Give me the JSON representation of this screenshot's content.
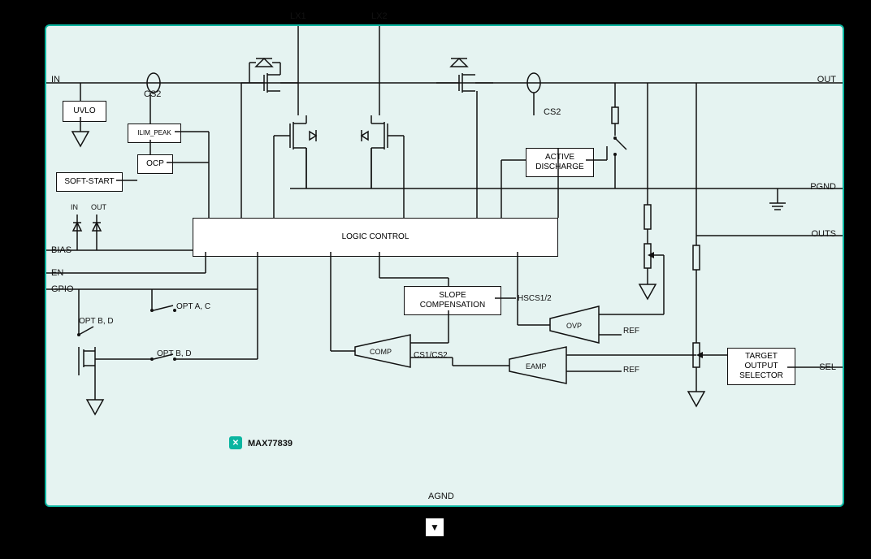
{
  "part": "MAX77839",
  "pins": {
    "in": "IN",
    "out": "OUT",
    "lx1": "LX1",
    "lx2": "LX2",
    "bias": "BIAS",
    "en": "EN",
    "gpio": "GPIO",
    "pgnd": "PGND",
    "outs": "OUTS",
    "sel": "SEL",
    "agnd": "AGND"
  },
  "blocks": {
    "uvlo": "UVLO",
    "ilim": "ILIM_PEAK",
    "ocp": "OCP",
    "softstart": "SOFT-START",
    "logic": "LOGIC CONTROL",
    "slope": "SLOPE COMPENSATION",
    "active": "ACTIVE DISCHARGE",
    "target": "TARGET OUTPUT SELECTOR",
    "ovp": "OVP",
    "eamp": "EAMP",
    "comp": "COMP"
  },
  "labels": {
    "cs2a": "CS2",
    "cs2b": "CS2",
    "in_small": "IN",
    "out_small": "OUT",
    "opt_ac": "OPT A, C",
    "opt_bd1": "OPT B, D",
    "opt_bd2": "OPT B, D",
    "hscs": "HSCS1/2",
    "cs12": "CS1/CS2",
    "ref1": "REF",
    "ref2": "REF"
  }
}
